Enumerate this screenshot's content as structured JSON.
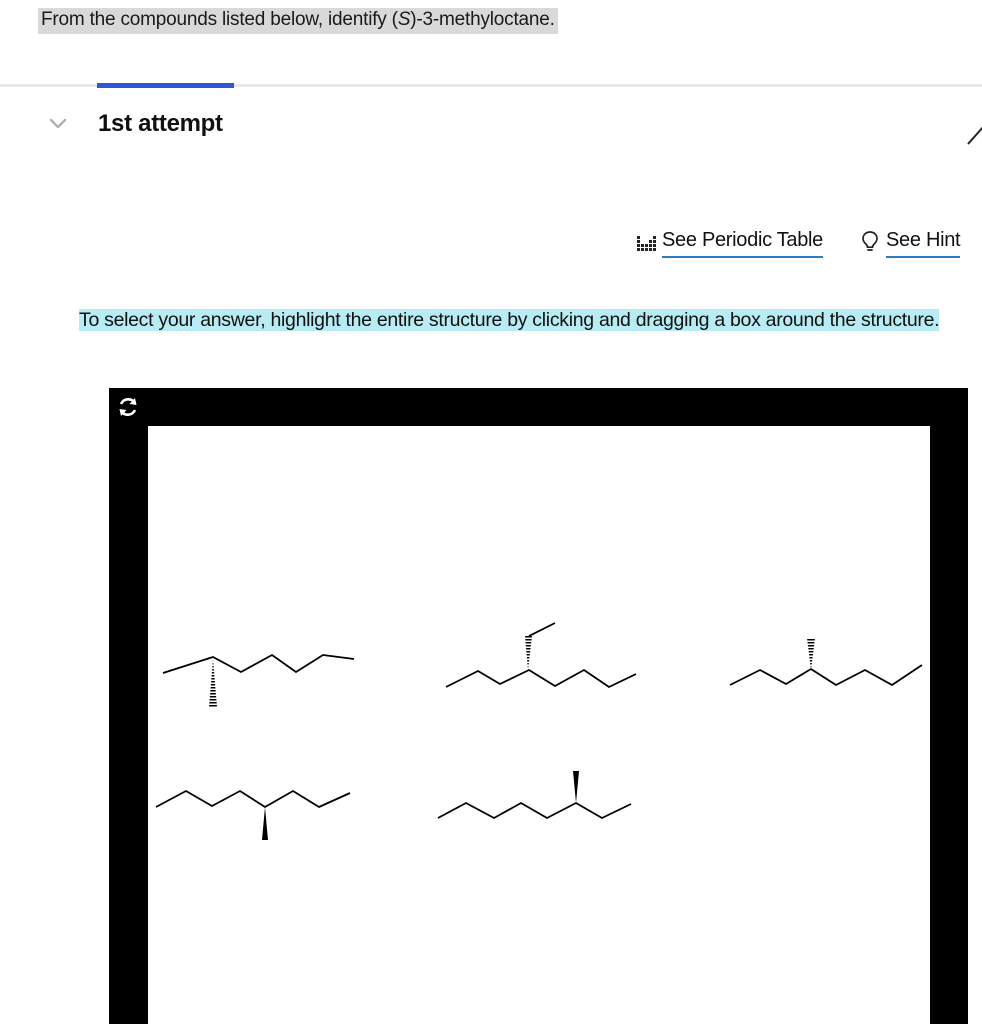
{
  "question": {
    "prefix": "From the compounds listed below, identify (",
    "italic": "S",
    "suffix": ")-3-methyloctane."
  },
  "attempt": {
    "title": "1st attempt"
  },
  "tools": {
    "periodic_table_label": "See Periodic Table",
    "hint_label": "See Hint"
  },
  "instruction": "To select your answer, highlight the entire structure by clicking and dragging a box around the structure.",
  "colors": {
    "accent": "#2f56d6",
    "link_underline": "#2a7cc0",
    "instruction_highlight": "#b8ecf5",
    "question_highlight": "#d9d9d9"
  },
  "icons": {
    "collapse": "chevron-down-icon",
    "edit": "pencil-icon",
    "periodic": "periodic-table-icon",
    "hint": "lightbulb-icon",
    "reset": "reset-icon"
  }
}
